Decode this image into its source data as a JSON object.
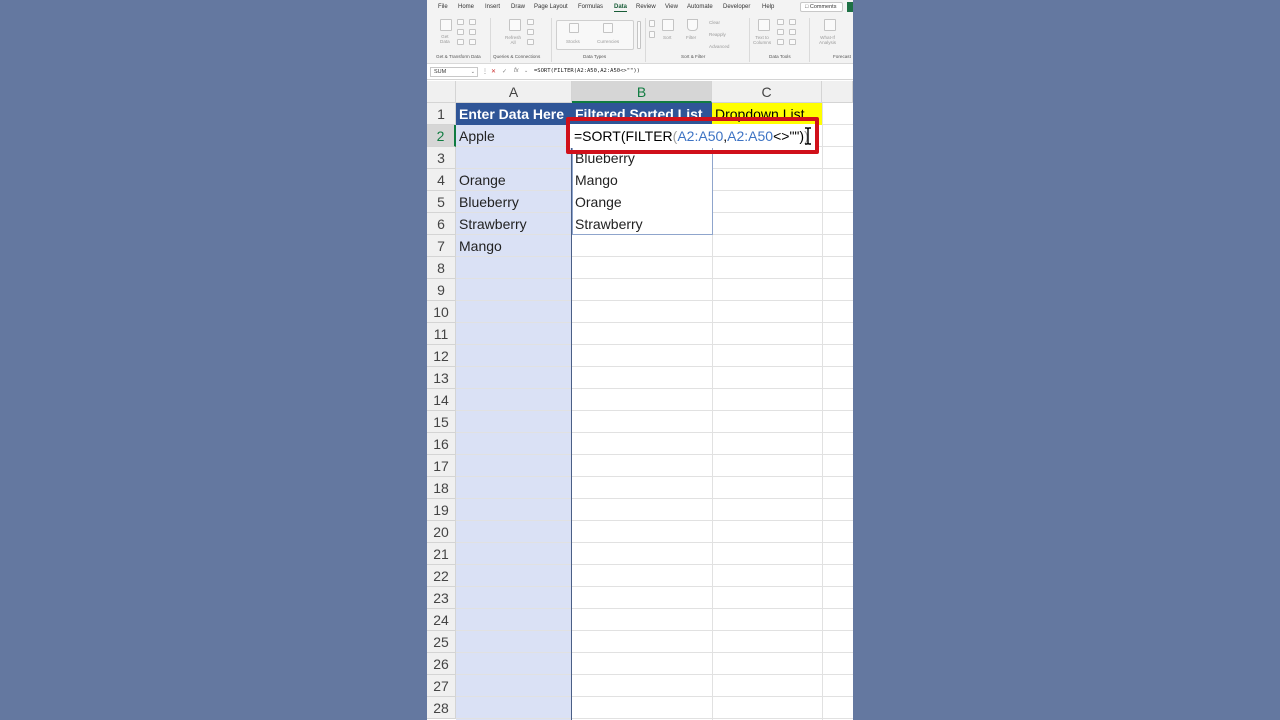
{
  "menu": {
    "tabs": [
      "File",
      "Home",
      "Insert",
      "Draw",
      "Page Layout",
      "Formulas",
      "Data",
      "Review",
      "View",
      "Automate",
      "Developer",
      "Help"
    ],
    "active_tab": "Data",
    "comments_label": "Comments"
  },
  "ribbon": {
    "buttons": {
      "get_data": "Get\nData",
      "refresh_all": "Refresh\nAll",
      "stocks": "Stocks",
      "currencies": "Currencies",
      "sort": "Sort",
      "filter": "Filter",
      "clear": "Clear",
      "reapply": "Reapply",
      "advanced": "Advanced",
      "text_to_columns": "Text to\nColumns",
      "what_if": "What-If\nAnalysis"
    },
    "groups": {
      "get_transform": "Get & Transform Data",
      "queries": "Queries & Connections",
      "data_types": "Data Types",
      "sort_filter": "Sort & Filter",
      "data_tools": "Data Tools",
      "forecast": "Forecast"
    }
  },
  "formula_bar": {
    "name_box": "SUM",
    "formula": "=SORT(FILTER(A2:A50,A2:A50<>\"\"))"
  },
  "grid": {
    "columns": [
      "A",
      "B",
      "C"
    ],
    "selected_column": "B",
    "rows": [
      "1",
      "2",
      "3",
      "4",
      "5",
      "6",
      "7",
      "8",
      "9",
      "10",
      "11",
      "12",
      "13",
      "14",
      "15",
      "16",
      "17",
      "18",
      "19",
      "20",
      "21",
      "22",
      "23",
      "24",
      "25",
      "26",
      "27",
      "28"
    ],
    "selected_row": "2",
    "header_a": "Enter Data Here",
    "header_b": "Filtered Sorted List",
    "header_c": "Dropdown List",
    "col_a_values": [
      "Apple",
      "",
      "Orange",
      "Blueberry",
      "Strawberry",
      "Mango"
    ],
    "col_b_values": [
      "",
      "Blueberry",
      "Mango",
      "Orange",
      "Strawberry"
    ],
    "edit_formula": {
      "prefix": "=SORT(FILTER",
      "open_paren": "(",
      "ref1": "A2:A50",
      "comma": ",",
      "ref2": "A2:A50",
      "suffix": "<>\"\")",
      "close_paren": ")"
    }
  },
  "colors": {
    "header_fill": "#2f5597",
    "dropdown_fill": "#ffff00",
    "col_a_fill": "#dae1f5",
    "highlight": "#d0101a",
    "excel_green": "#107c41"
  }
}
